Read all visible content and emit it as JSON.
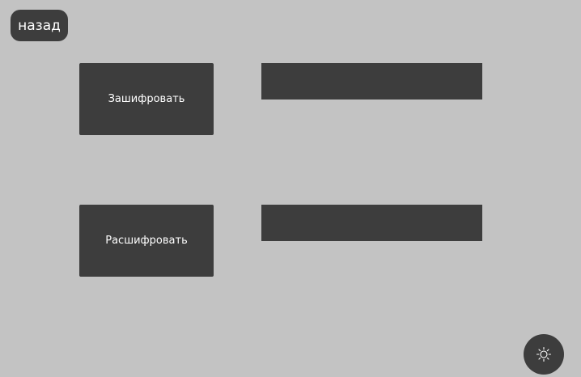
{
  "back_button": {
    "label": "назад"
  },
  "encrypt": {
    "button_label": "Зашифровать",
    "field_value": "",
    "field_placeholder": ""
  },
  "decrypt": {
    "button_label": "Расшифровать",
    "field_value": "",
    "field_placeholder": ""
  },
  "theme_toggle": {
    "icon": "sun-icon"
  },
  "colors": {
    "background": "#c3c3c3",
    "control": "#3d3d3d",
    "text": "#ffffff"
  }
}
